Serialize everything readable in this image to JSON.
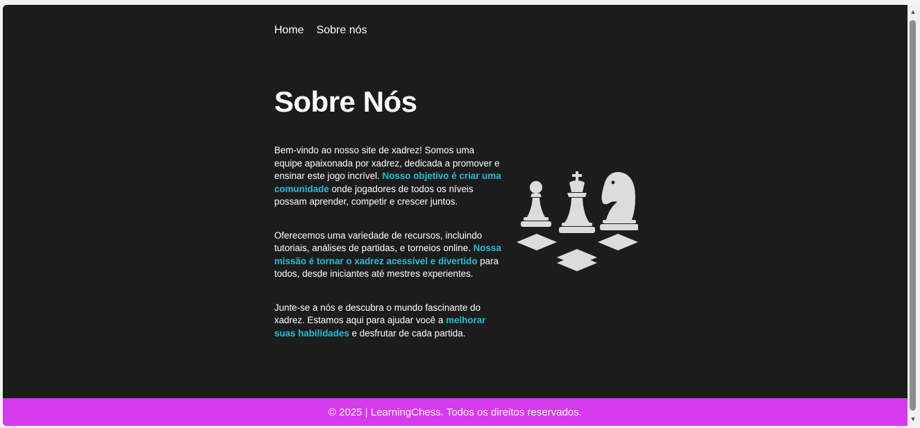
{
  "nav": {
    "items": [
      {
        "label": "Home"
      },
      {
        "label": "Sobre nós"
      }
    ]
  },
  "page": {
    "title": "Sobre Nós"
  },
  "paragraphs": [
    {
      "parts": [
        "Bem-vindo ao nosso site de xadrez! Somos uma equipe apaixonada por xadrez, dedicada a promover e ensinar este jogo incrível. ",
        "Nosso objetivo é criar uma comunidade",
        " onde jogadores de todos os níveis possam aprender, competir e crescer juntos."
      ]
    },
    {
      "parts": [
        "Oferecemos uma variedade de recursos, incluindo tutoriais, análises de partidas, e torneios online. ",
        "Nossa missão é tornar o xadrez acessível e divertido",
        " para todos, desde iniciantes até mestres experientes."
      ]
    },
    {
      "parts": [
        "Junte-se a nós e descubra o mundo fascinante do xadrez. Estamos aqui para ajudar você a ",
        "melhorar suas habilidades",
        " e desfrutar de cada partida."
      ]
    }
  ],
  "illustration": {
    "icon": "chess-pieces-icon",
    "pieces": [
      "pawn",
      "king",
      "knight"
    ],
    "color": "#dcdcdc"
  },
  "footer": {
    "text": "© 2025 | LearningChess. Todos os direitos reservados.",
    "background": "#d63aee"
  },
  "colors": {
    "background": "#1c1c1c",
    "highlight": "#1fbfd8",
    "text": "#ffffff"
  },
  "scrollbar": {
    "up_icon": "scroll-up-arrow-icon",
    "down_icon": "scroll-down-arrow-icon"
  }
}
